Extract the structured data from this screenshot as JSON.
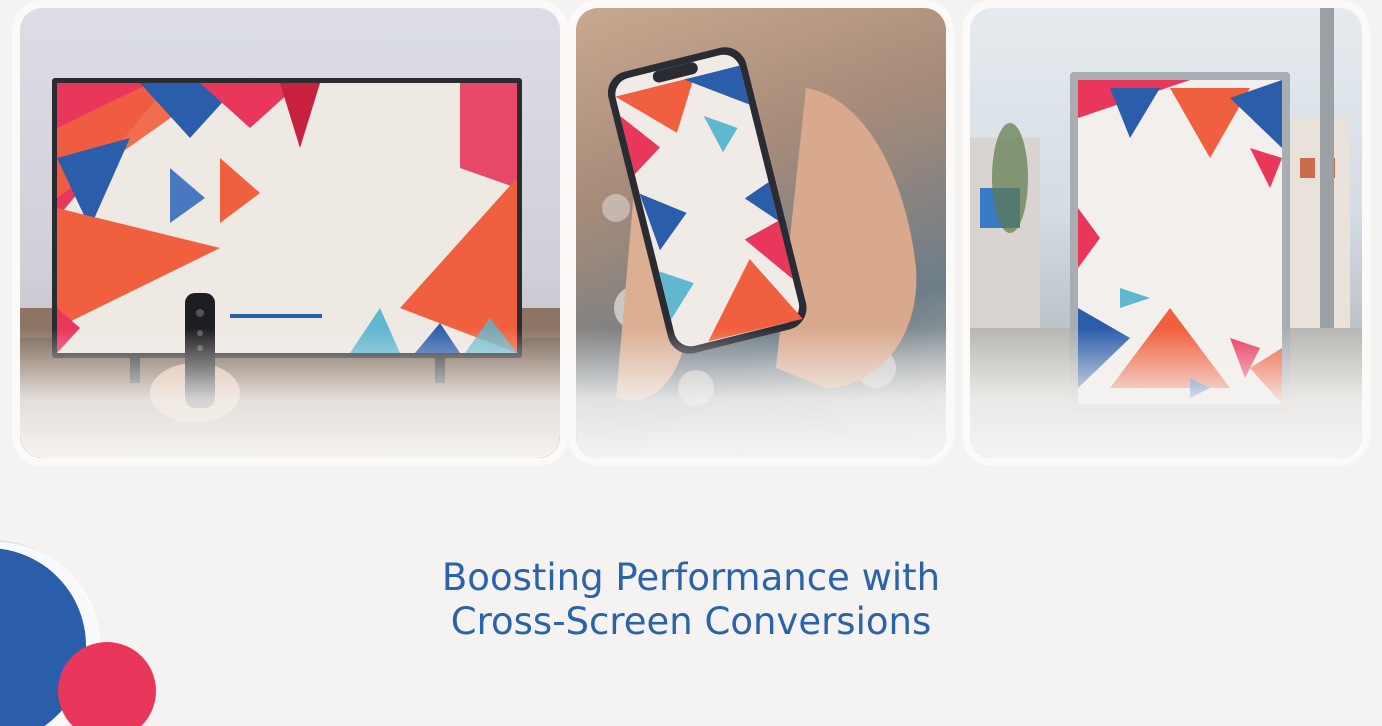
{
  "headline": {
    "line1": "Boosting Performance with",
    "line2": "Cross-Screen Conversions"
  },
  "hero": {
    "panels": [
      "tv",
      "phone",
      "poster"
    ]
  },
  "colors": {
    "background": "#f5f3f1",
    "headline": "#2b63a8",
    "brand_blue": "#2b5eaa",
    "brand_red": "#e8375a",
    "accent_orange": "#f0603e"
  }
}
